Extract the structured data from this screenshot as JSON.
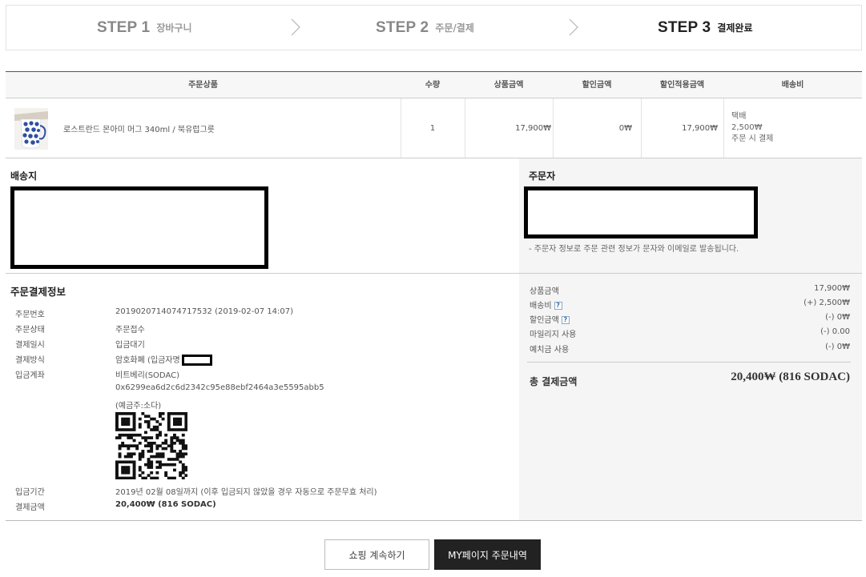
{
  "steps": [
    {
      "num": "STEP 1",
      "name": "장바구니"
    },
    {
      "num": "STEP 2",
      "name": "주문/결제"
    },
    {
      "num": "STEP 3",
      "name": "결제완료"
    }
  ],
  "table": {
    "headers": [
      "주문상품",
      "수량",
      "상품금액",
      "할인금액",
      "할인적용금액",
      "배송비"
    ],
    "row": {
      "product": "로스트란드 몬아미 머그 340ml / 북유럽그릇",
      "qty": "1",
      "price": "17,900₩",
      "discount": "0₩",
      "discounted_price": "17,900₩",
      "shipping_method": "택배",
      "shipping_fee": "2,500₩",
      "shipping_note": "주문 시 결제"
    }
  },
  "shipping": {
    "title": "배송지"
  },
  "orderer": {
    "title": "주문자",
    "note": "- 주문자 정보로 주문 관련 정보가 문자와 이메일로 발송됩니다."
  },
  "payment_info": {
    "title": "주문결제정보",
    "order_no_label": "주문번호",
    "order_no": "2019020714074717532 (2019-02-07 14:07)",
    "status_label": "주문상태",
    "status": "주문접수",
    "pay_date_label": "결제일시",
    "pay_date": "입금대기",
    "method_label": "결제방식",
    "method": "암호화폐 (입금자명",
    "account_label": "입금계좌",
    "account_name": "비트베리(SODAC)",
    "account_address": "0x6299ea6d2c6d2342c95e88ebf2464a3e5595abb5",
    "account_holder": "(예금주:소다)",
    "deadline_label": "입금기간",
    "deadline": "2019년 02월 08일까지 (이후 입금되지 않았을 경우 자동으로 주문무효 처리)",
    "amount_label": "결제금액",
    "amount": "20,400₩ (816 SODAC)"
  },
  "summary": {
    "items": [
      {
        "label": "상품금액",
        "value": "17,900₩",
        "help": false
      },
      {
        "label": "배송비",
        "value": "(+) 2,500₩",
        "help": true
      },
      {
        "label": "할인금액",
        "value": "(-) 0₩",
        "help": true
      },
      {
        "label": "마일리지 사용",
        "value": "(-) 0.00",
        "help": false
      },
      {
        "label": "예치금 사용",
        "value": "(-) 0₩",
        "help": false
      }
    ],
    "total_label": "총 결제금액",
    "total_value": "20,400₩ (816 SODAC)",
    "help_glyph": "?"
  },
  "buttons": {
    "continue": "쇼핑 계속하기",
    "mypage": "MY페이지 주문내역"
  },
  "icons": {
    "step_separator": "chevron-right-icon",
    "help": "question-icon"
  }
}
